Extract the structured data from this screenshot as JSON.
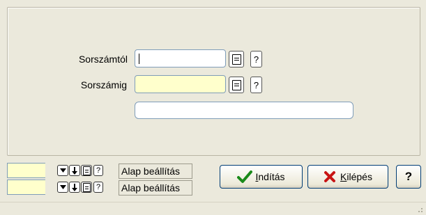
{
  "form": {
    "from_label": "Sorszámtól",
    "from_value": "",
    "to_label": "Sorszámig",
    "to_value": "",
    "extra_value": "",
    "help_glyph": "?"
  },
  "filters": [
    {
      "value": "",
      "preset_label": "Alap beállítás"
    },
    {
      "value": "",
      "preset_label": "Alap beállítás"
    }
  ],
  "buttons": {
    "start": {
      "access_key": "I",
      "rest": "ndítás",
      "icon": "check-icon",
      "icon_color": "#1a8a1a"
    },
    "exit": {
      "access_key": "K",
      "rest": "ilépés",
      "icon": "x-icon",
      "icon_color": "#c81414"
    },
    "help": "?"
  }
}
